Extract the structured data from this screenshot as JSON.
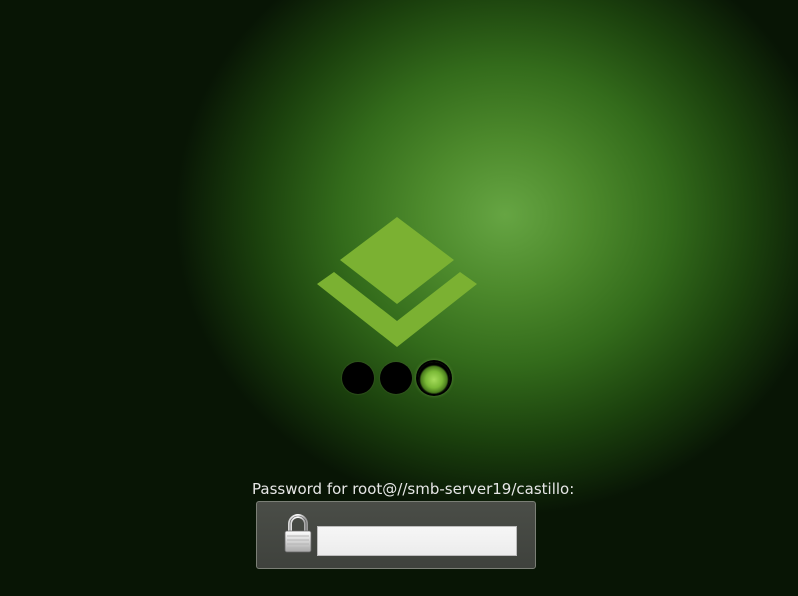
{
  "boot_splash": {
    "logo_icon": "layers-icon",
    "progress": {
      "total_dots": 3,
      "active_index": 2
    }
  },
  "password_prompt": {
    "label": "Password for root@//smb-server19/castillo:",
    "lock_icon": "padlock-icon",
    "input_value": "",
    "input_placeholder": ""
  },
  "colors": {
    "logo_green": "#7bb132",
    "active_dot_green": "#8cc63f",
    "background_center": "#66a543",
    "background_edge": "#000000"
  }
}
